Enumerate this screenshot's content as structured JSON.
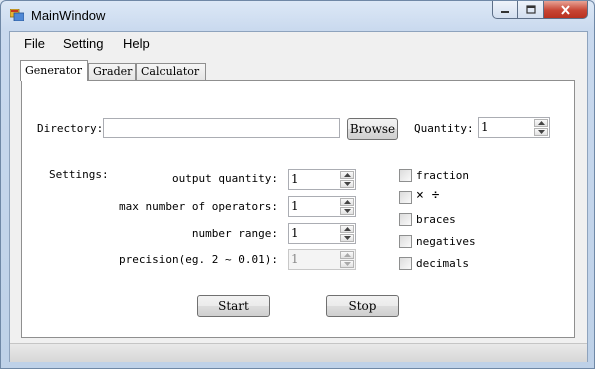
{
  "window": {
    "title": "MainWindow",
    "icon": "app-window-icon"
  },
  "menu": {
    "items": [
      "File",
      "Setting",
      "Help"
    ]
  },
  "tabs": [
    {
      "label": "Generator",
      "active": true
    },
    {
      "label": "Grader",
      "active": false
    },
    {
      "label": "Calculator",
      "active": false
    }
  ],
  "generator": {
    "directory_label": "Directory:",
    "directory_value": "",
    "browse_label": "Browse",
    "quantity_label": "Quantity:",
    "quantity_value": "1",
    "settings_label": "Settings:",
    "fields": [
      {
        "label": "output quantity:",
        "value": "1",
        "enabled": true
      },
      {
        "label": "max number of operators:",
        "value": "1",
        "enabled": true
      },
      {
        "label": "number range:",
        "value": "1",
        "enabled": true
      },
      {
        "label": "precision(eg. 2 ~ 0.01):",
        "value": "1",
        "enabled": false
      }
    ],
    "options": [
      {
        "label": "fraction",
        "checked": false
      },
      {
        "label": "× ÷",
        "checked": false
      },
      {
        "label": "braces",
        "checked": false
      },
      {
        "label": "negatives",
        "checked": false
      },
      {
        "label": "decimals",
        "checked": false
      }
    ],
    "start_label": "Start",
    "stop_label": "Stop"
  }
}
